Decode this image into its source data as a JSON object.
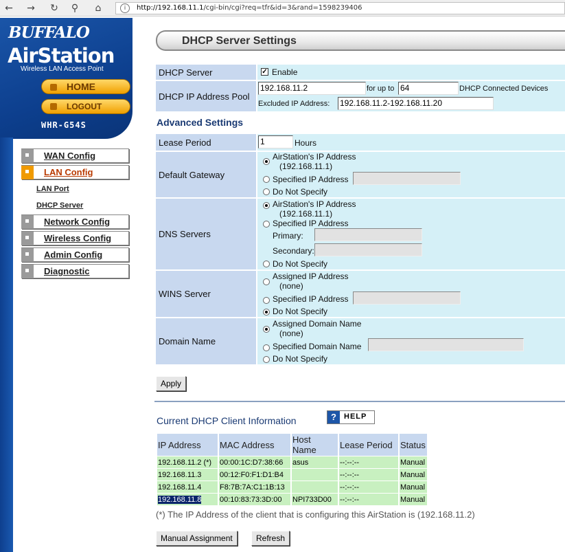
{
  "browser": {
    "url_host": "http://192.168.11.1",
    "url_path": "/cgi-bin/cgi?req=tfr&id=3&rand=1598239406",
    "icons": [
      "back-arrow-icon",
      "forward-arrow-icon",
      "reload-icon",
      "key-icon",
      "home-icon",
      "site-info-icon"
    ]
  },
  "brand": {
    "name": "BUFFALO",
    "product": "AirStation",
    "tagline": "Wireless LAN Access Point",
    "model": "WHR-G54S",
    "home_label": "HOME",
    "logout_label": "LOGOUT"
  },
  "nav": {
    "items": [
      {
        "label": "WAN Config",
        "active": false
      },
      {
        "label": "LAN Config",
        "active": true
      },
      {
        "label": "Network Config",
        "active": false
      },
      {
        "label": "Wireless Config",
        "active": false
      },
      {
        "label": "Admin Config",
        "active": false
      },
      {
        "label": "Diagnostic",
        "active": false
      }
    ],
    "sub_items": [
      "LAN Port",
      "DHCP Server"
    ]
  },
  "page": {
    "title": "DHCP Server Settings"
  },
  "dhcp": {
    "server_label": "DHCP Server",
    "enable_label": "Enable",
    "enabled": true,
    "pool_label": "DHCP IP Address Pool",
    "pool_start": "192.168.11.2",
    "for_up_to": "for up to",
    "pool_count": "64",
    "connected_devices": "DHCP Connected Devices",
    "excluded_label": "Excluded IP Address:",
    "excluded_value": "192.168.11.2-192.168.11.20"
  },
  "advanced": {
    "title": "Advanced Settings",
    "lease_label": "Lease Period",
    "lease_value": "1",
    "lease_unit": "Hours",
    "gateway_label": "Default Gateway",
    "gateway_opt1": "AirStation's IP Address",
    "gateway_opt1_sub": "(192.168.11.1)",
    "gateway_opt2": "Specified IP Address",
    "gateway_opt3": "Do Not Specify",
    "dns_label": "DNS Servers",
    "dns_opt1": "AirStation's IP Address",
    "dns_opt1_sub": "(192.168.11.1)",
    "dns_opt2": "Specified IP Address",
    "dns_primary": "Primary:",
    "dns_secondary": "Secondary:",
    "dns_opt3": "Do Not Specify",
    "wins_label": "WINS Server",
    "wins_opt1": "Assigned IP Address",
    "wins_opt1_sub": "(none)",
    "wins_opt2": "Specified IP Address",
    "wins_opt3": "Do Not Specify",
    "domain_label": "Domain Name",
    "domain_opt1": "Assigned Domain Name",
    "domain_opt1_sub": "(none)",
    "domain_opt2": "Specified Domain Name",
    "domain_opt3": "Do Not Specify",
    "apply_label": "Apply"
  },
  "clients": {
    "title": "Current DHCP Client Information",
    "help_label": "HELP",
    "columns": [
      "IP Address",
      "MAC Address",
      "Host Name",
      "Lease Period",
      "Status"
    ],
    "rows": [
      [
        "192.168.11.2 (*)",
        "00:00:1C:D7:38:66",
        "asus",
        "--:--:--",
        "Manual"
      ],
      [
        "192.168.11.3",
        "00:12:F0:F1:D1:B4",
        "",
        "--:--:--",
        "Manual"
      ],
      [
        "192.168.11.4",
        "F8:7B:7A:C1:1B:13",
        "",
        "--:--:--",
        "Manual"
      ],
      [
        "192.168.11.8",
        "00:10:83:73:3D:00",
        "NPI733D00",
        "--:--:--",
        "Manual"
      ]
    ],
    "footnote": "(*) The IP Address of the client that is configuring this AirStation is (192.168.11.2)",
    "manual_label": "Manual Assignment",
    "refresh_label": "Refresh"
  }
}
